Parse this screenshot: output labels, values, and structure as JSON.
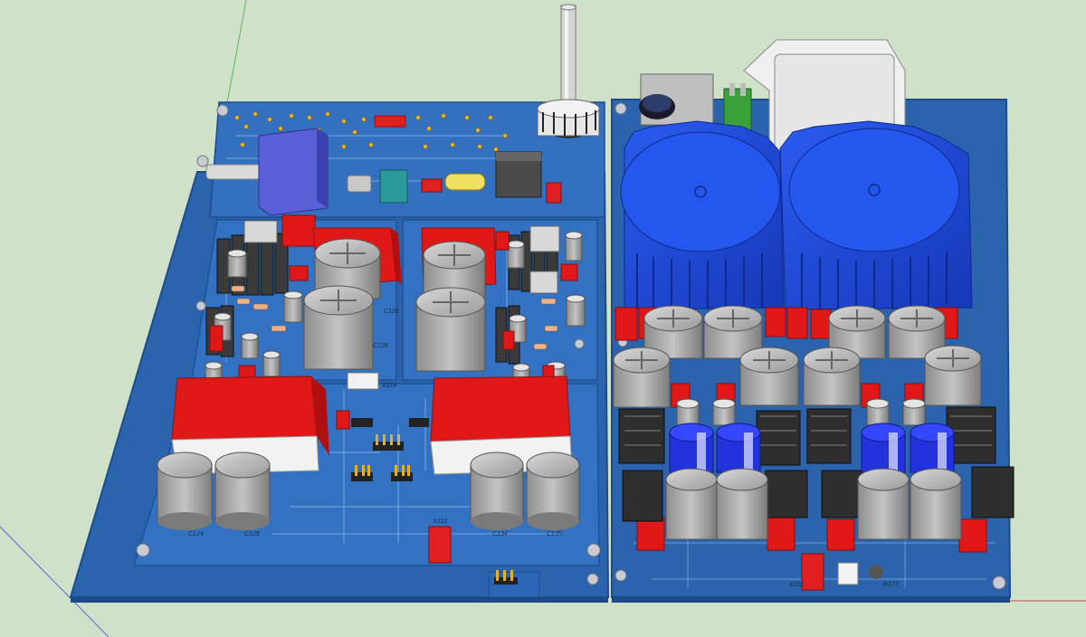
{
  "scene": {
    "background_color": "#cfe1c9",
    "pcb_color": "#2f6bb8",
    "heatsink_color": "#1f4fe0",
    "capacitor_color": "#a8a8a8",
    "film_cap_color": "#e01818",
    "electrolytic_blue": "#2233dd"
  },
  "labels": {
    "c124": "C124",
    "c125": "C125",
    "c126": "C126",
    "c128": "C128",
    "c134": "C134",
    "c135": "C135",
    "x124": "X124",
    "x122": "X122",
    "x151": "X151",
    "r177": "R177"
  }
}
